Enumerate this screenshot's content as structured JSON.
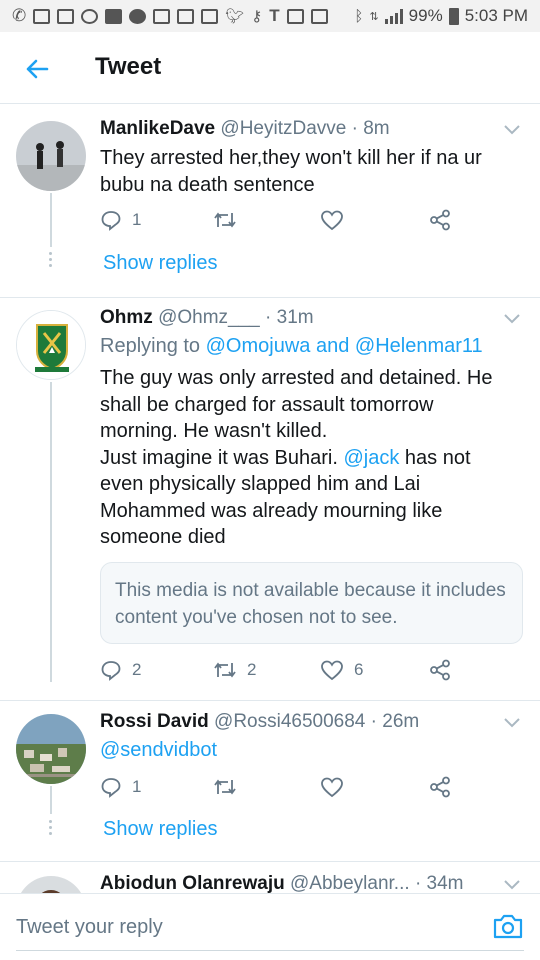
{
  "status_bar": {
    "battery": "99%",
    "time": "5:03 PM",
    "icons": [
      "phone-icon",
      "mail-icon",
      "mail-icon",
      "voicemail-icon",
      "chat-icon",
      "messenger-icon",
      "gmail-icon",
      "flipboard-icon",
      "photos-icon",
      "twitter-icon",
      "key-icon",
      "t-icon",
      "instagram-icon",
      "instagram-icon",
      "bluetooth-icon",
      "data-icon",
      "signal-icon",
      "battery-icon"
    ]
  },
  "header": {
    "title": "Tweet",
    "back_icon": "arrow-left-icon"
  },
  "tweets": [
    {
      "name": "ManlikeDave",
      "handle": "@HeyitzDavve",
      "time": "· 8m",
      "text_lines": [
        "They arrested her,they won't kill her if na ur",
        "bubu na death sentence"
      ],
      "replies": "1",
      "retweets": "",
      "likes": "",
      "show_replies": "Show replies"
    },
    {
      "name": "Ohmz",
      "handle": "@Ohmz___",
      "time": "· 31m",
      "replying_prefix": "Replying to",
      "replying_to_1": "@Omojuwa",
      "replying_and": "and",
      "replying_to_2": "@Helenmar11",
      "text_lines": [
        "The guy was only arrested and detained. He",
        "shall be charged for assault tomorrow",
        "morning. He wasn't killed.",
        "Just imagine it was Buhari."
      ],
      "mention": "@jack",
      "text_after_mention": "has not",
      "text_lines_2": [
        "even physically slapped him and Lai",
        "Mohammed was already mourning like",
        "someone died"
      ],
      "media_notice": "This media is not available because it includes content you've chosen not to see.",
      "replies": "2",
      "retweets": "2",
      "likes": "6"
    },
    {
      "name": "Rossi David",
      "handle": "@Rossi46500684",
      "time": "· 26m",
      "text": "@sendvidbot",
      "replies": "1",
      "retweets": "",
      "likes": "",
      "show_replies": "Show replies"
    },
    {
      "name": "Abiodun Olanrewaju",
      "handle": "@Abbeylanr...",
      "time": "· 34m"
    }
  ],
  "composer": {
    "placeholder": "Tweet your reply",
    "camera_icon": "camera-icon"
  },
  "colors": {
    "accent": "#1da1f2",
    "secondary_text": "#657786",
    "primary_text": "#14171a",
    "divider": "#e1e8ed"
  }
}
